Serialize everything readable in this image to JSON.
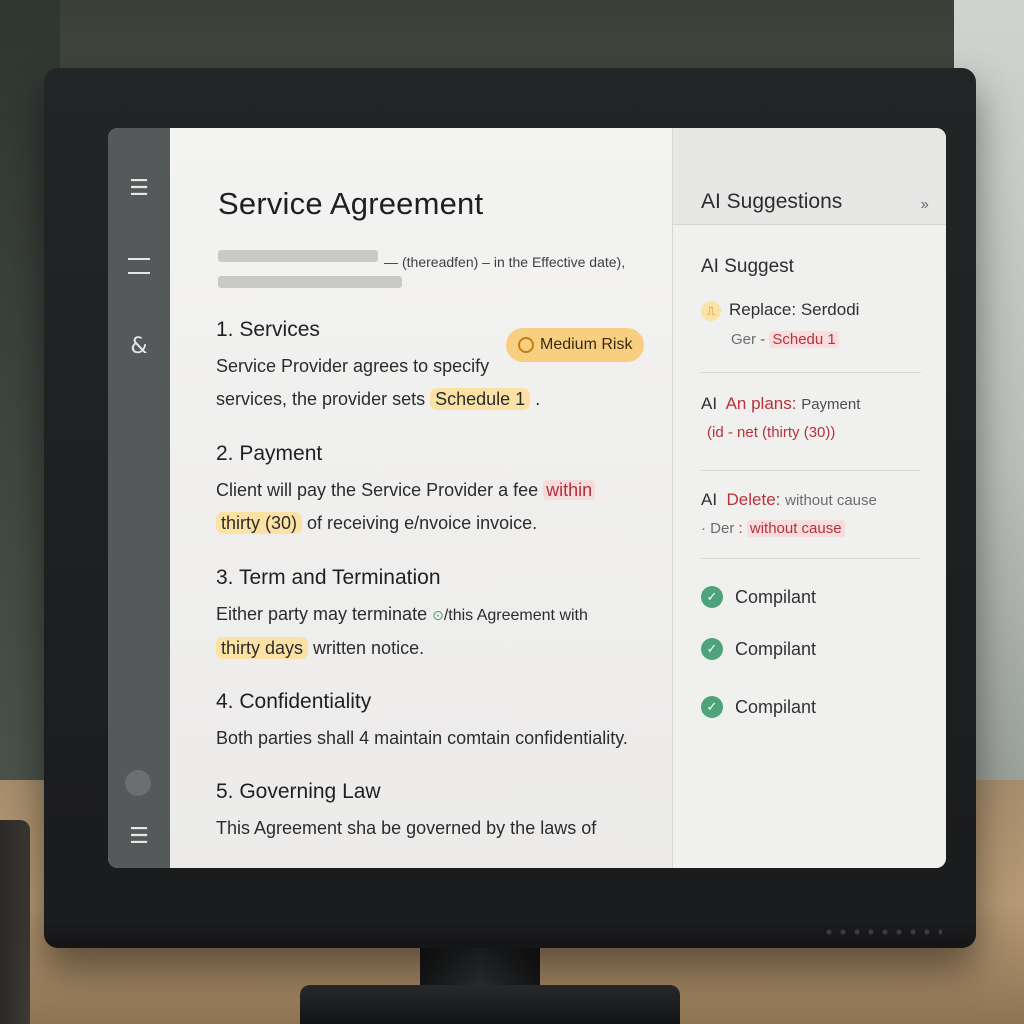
{
  "document": {
    "title": "Service Agreement",
    "meta_dash": "—",
    "meta_text": "(thereadfen) – in the Effective date),",
    "risk_badge": "Medium Risk",
    "sections": [
      {
        "heading": "1. Services",
        "line1": "Service Provider agrees to specify",
        "line2_pre": "services, the provider sets",
        "line2_hl": "Schedule 1",
        "line2_post": "."
      },
      {
        "heading": "2. Payment",
        "line1_pre": "Client will pay the Service Provider",
        "line1_mid": " a fee ",
        "line1_hl": "within",
        "line2_hl": "thirty (30)",
        "line2_post": " of receiving e/nvoice invoice."
      },
      {
        "heading": "3. Term and Termination",
        "line1_pre": "Either party may terminate",
        "line1_icon": "⊙",
        "line1_post": "/this  Agreement with",
        "line2_hl": "thirty days",
        "line2_post": " written notice."
      },
      {
        "heading": "4. Confidentiality",
        "line1": "Both parties shall 4 maintain comtain confidentiality."
      },
      {
        "heading": "5. Governing Law",
        "line1": "This Agreement sha be governed by the  laws of"
      }
    ]
  },
  "panel": {
    "title": "AI Suggestions",
    "collapse_icon": "››",
    "subheader": "AI Suggest",
    "cards": [
      {
        "prefix": "",
        "icon": "⎍",
        "action": "Replace:",
        "value": "Serdodi",
        "sub_prefix": "Ger",
        "sub_dash": "-",
        "sub_value": "Schedu 1"
      },
      {
        "prefix": "AI",
        "action": "An plans:",
        "value": "Payment",
        "sub_prefix": "(id",
        "sub_dash": "-",
        "sub_value": "net  (thirty (30))"
      },
      {
        "prefix": "AI",
        "action": "Delete:",
        "value": "without  cause",
        "sub_prefix": "· Der",
        "sub_dash": ":",
        "sub_value": "without cause"
      }
    ],
    "compliance": [
      {
        "label": "Compilant"
      },
      {
        "label": "Compilant"
      },
      {
        "label": "Compilant"
      }
    ]
  },
  "icons": {
    "check": "✓",
    "menu": "☰",
    "dash_double": "—",
    "user_edit": "&"
  }
}
